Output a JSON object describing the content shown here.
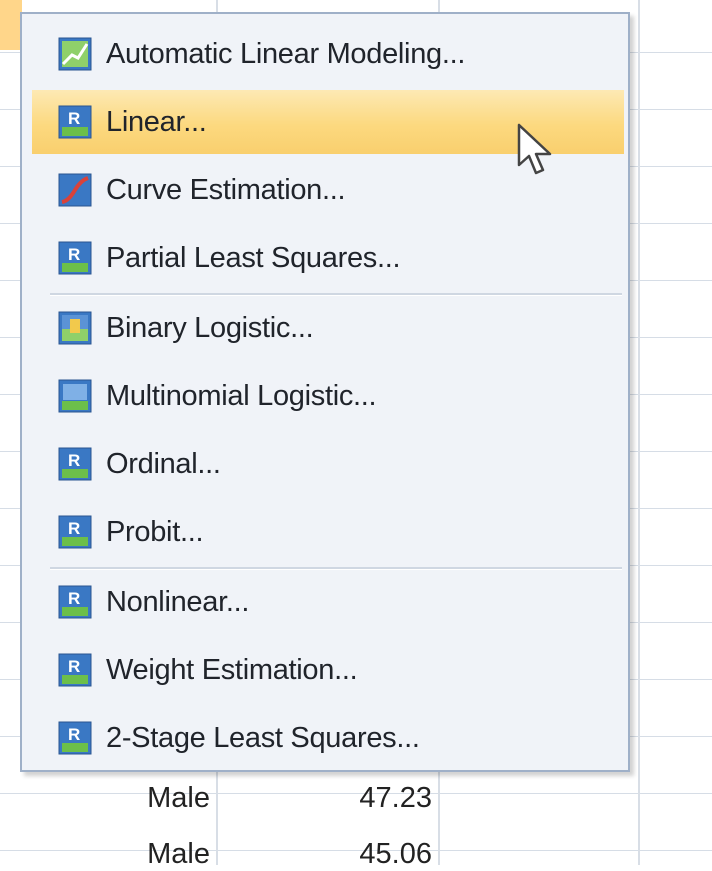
{
  "menu": {
    "items": [
      {
        "label": "Automatic Linear Modeling...",
        "icon": "automatic-linear-modeling-icon",
        "highlighted": false
      },
      {
        "label": "Linear...",
        "icon": "linear-regression-icon",
        "highlighted": true
      },
      {
        "label": "Curve Estimation...",
        "icon": "curve-estimation-icon",
        "highlighted": false
      },
      {
        "label": "Partial Least Squares...",
        "icon": "partial-least-squares-icon",
        "highlighted": false
      },
      {
        "label": "Binary Logistic...",
        "icon": "binary-logistic-icon",
        "highlighted": false
      },
      {
        "label": "Multinomial Logistic...",
        "icon": "multinomial-logistic-icon",
        "highlighted": false
      },
      {
        "label": "Ordinal...",
        "icon": "ordinal-icon",
        "highlighted": false
      },
      {
        "label": "Probit...",
        "icon": "probit-icon",
        "highlighted": false
      },
      {
        "label": "Nonlinear...",
        "icon": "nonlinear-icon",
        "highlighted": false
      },
      {
        "label": "Weight Estimation...",
        "icon": "weight-estimation-icon",
        "highlighted": false
      },
      {
        "label": "2-Stage Least Squares...",
        "icon": "two-stage-least-squares-icon",
        "highlighted": false
      }
    ]
  },
  "sheet": {
    "rows": [
      {
        "gender": "Male",
        "value": "47.23"
      },
      {
        "gender": "Male",
        "value": "45.06"
      }
    ]
  },
  "colors": {
    "highlight": "#fcd97f",
    "menu_bg": "#f0f3f8",
    "menu_border": "#9fb0c8",
    "icon_blue": "#3a78c4",
    "icon_green": "#6cbf4a"
  }
}
